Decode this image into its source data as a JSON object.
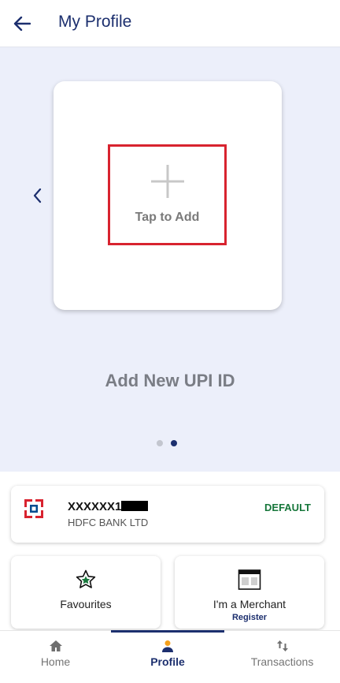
{
  "header": {
    "title": "My Profile",
    "back_icon": "arrow-left-icon"
  },
  "hero": {
    "add_label": "Tap to Add",
    "caption": "Add New UPI ID",
    "pagination": {
      "total": 2,
      "current": 2
    },
    "prev_icon": "chevron-left-icon",
    "plus_icon": "plus-icon",
    "highlight_color": "#d8232f"
  },
  "account": {
    "number": "XXXXXX1",
    "bank": "HDFC BANK LTD",
    "badge": "DEFAULT",
    "logo_icon": "hdfc-logo-icon",
    "badge_color": "#17773b"
  },
  "tiles": {
    "favourites": {
      "label": "Favourites",
      "icon": "star-icon"
    },
    "merchant": {
      "label": "I'm a Merchant",
      "sublabel": "Register",
      "icon": "store-icon"
    }
  },
  "nav": {
    "items": [
      {
        "label": "Home",
        "icon": "home-icon"
      },
      {
        "label": "Profile",
        "icon": "person-icon",
        "active": true
      },
      {
        "label": "Transactions",
        "icon": "transfer-arrows-icon"
      }
    ]
  },
  "colors": {
    "primary": "#1c2f6e",
    "hero_bg": "#eceffa"
  }
}
